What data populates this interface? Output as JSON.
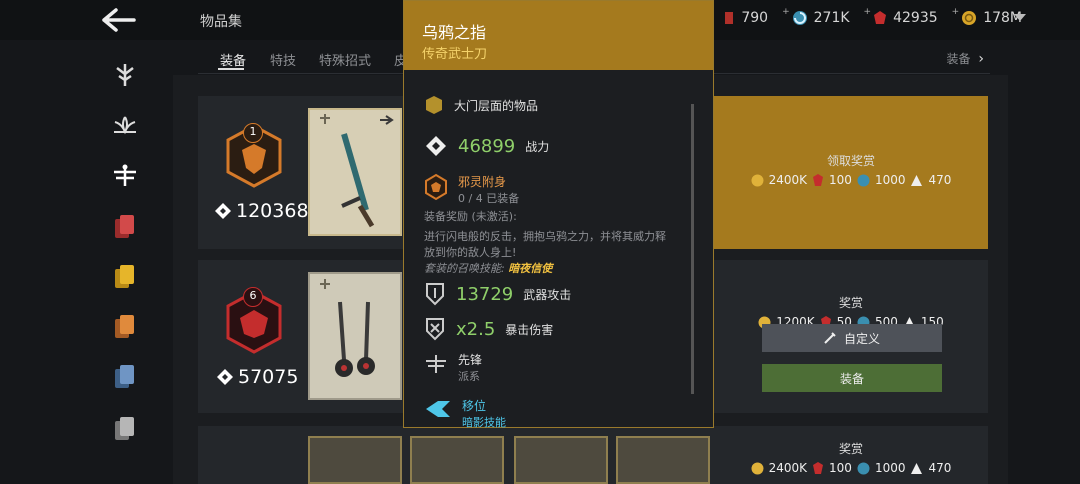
{
  "header": {
    "title": "物品集"
  },
  "currencies": [
    {
      "icon": "token-icon",
      "value": "790"
    },
    {
      "icon": "spiral-icon",
      "value": "271K"
    },
    {
      "icon": "ruby-icon",
      "value": "42935"
    },
    {
      "icon": "coin-icon",
      "value": "178M"
    }
  ],
  "tabs": [
    "装备",
    "特技",
    "特殊招式",
    "皮"
  ],
  "tabs_right": "装备",
  "rows": [
    {
      "badge": "1",
      "power": "120368",
      "reward": {
        "title": "领取奖赏",
        "coins": "2400K",
        "ruby": "100",
        "spiral": "1000",
        "token": "470"
      }
    },
    {
      "badge": "6",
      "power": "57075",
      "reward": {
        "title": "奖赏",
        "coins": "1200K",
        "ruby": "50",
        "spiral": "500",
        "token": "150"
      },
      "btn_custom": "自定义",
      "btn_equip": "装备"
    },
    {
      "reward": {
        "title": "奖赏",
        "coins": "2400K",
        "ruby": "100",
        "spiral": "1000",
        "token": "470"
      }
    }
  ],
  "panel": {
    "name": "乌鸦之指",
    "rarity": "传奇武士刀",
    "gate": "大门层面的物品",
    "power_value": "46899",
    "power_label": "战力",
    "set_name": "邪灵附身",
    "set_count": "0 / 4 已装备",
    "set_bonus": "装备奖励 (未激活):",
    "set_desc1": "进行闪电般的反击，拥抱乌鸦之力，并将其威力释",
    "set_desc2": "放到你的敌人身上!",
    "summon_label": "套装的召唤技能:",
    "summon_name": "暗夜信使",
    "atk_value": "13729",
    "atk_label": "武器攻击",
    "crit_value": "x2.5",
    "crit_label": "暴击伤害",
    "class_name": "先锋",
    "class_sub": "派系",
    "skill_name": "移位",
    "skill_sub": "暗影技能"
  },
  "colors": {
    "gold": "#a57a1e",
    "green": "#5a7a3a",
    "accent_green": "#8fcf6a"
  }
}
